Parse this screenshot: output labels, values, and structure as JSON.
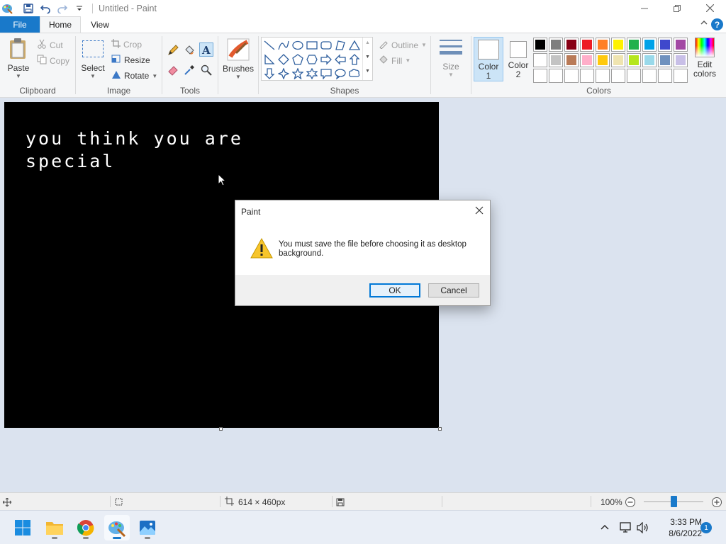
{
  "window": {
    "title": "Untitled - Paint"
  },
  "tabs": {
    "file": "File",
    "home": "Home",
    "view": "View"
  },
  "ribbon": {
    "clipboard": {
      "label": "Clipboard",
      "paste": "Paste",
      "cut": "Cut",
      "copy": "Copy"
    },
    "image": {
      "label": "Image",
      "select": "Select",
      "crop": "Crop",
      "resize": "Resize",
      "rotate": "Rotate"
    },
    "tools": {
      "label": "Tools"
    },
    "brushes": {
      "label": "Brushes"
    },
    "shapes": {
      "label": "Shapes",
      "outline": "Outline",
      "fill": "Fill"
    },
    "size": {
      "label": "Size"
    },
    "colors": {
      "label": "Colors",
      "color1_line1": "Color",
      "color1_line2": "1",
      "color2_line1": "Color",
      "color2_line2": "2",
      "edit_line1": "Edit",
      "edit_line2": "colors",
      "row1": [
        "#000000",
        "#7f7f7f",
        "#880015",
        "#ed1c24",
        "#ff7f27",
        "#fff200",
        "#22b14c",
        "#00a2e8",
        "#3f48cc",
        "#a349a4"
      ],
      "row2": [
        "#ffffff",
        "#c3c3c3",
        "#b97a57",
        "#ffaec9",
        "#ffc90e",
        "#efe4b0",
        "#b5e61d",
        "#99d9ea",
        "#7092be",
        "#c8bfe7"
      ],
      "row3_count": 10
    }
  },
  "canvas": {
    "text": "you think you are\nspecial",
    "background": "#000000",
    "text_color": "#ffffff"
  },
  "dialog": {
    "title": "Paint",
    "message": "You must save the file before choosing it as desktop background.",
    "ok": "OK",
    "cancel": "Cancel"
  },
  "statusbar": {
    "dimensions": "614 × 460px",
    "zoom": "100%"
  },
  "taskbar": {
    "time": "3:33 PM",
    "date": "8/6/2022",
    "notifications": "1",
    "apps": [
      "start-icon",
      "file-explorer-icon",
      "chrome-icon",
      "paint-icon",
      "photos-icon"
    ]
  },
  "colors": {
    "accent": "#1979ca",
    "workspace": "#dbe3ef"
  }
}
